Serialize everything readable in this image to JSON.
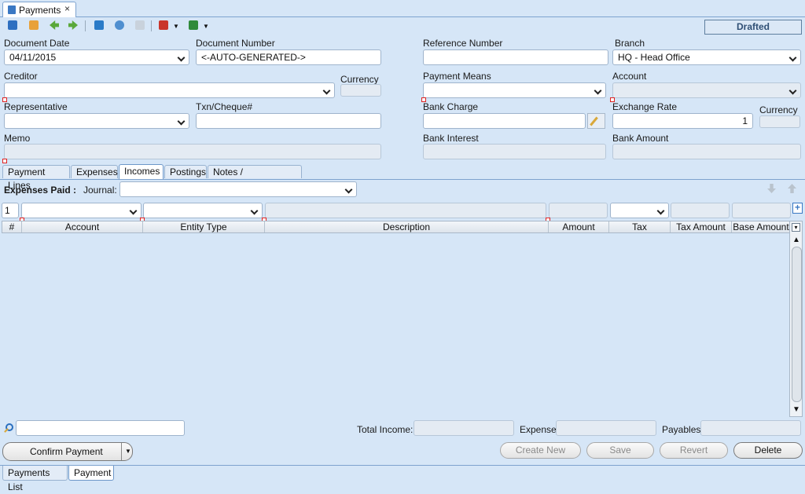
{
  "window": {
    "tab_title": "Payments",
    "close_glyph": "×",
    "status": "Drafted"
  },
  "toolbar": {
    "icons": [
      "help-icon",
      "calendar-icon",
      "back-icon",
      "forward-icon",
      "save-icon",
      "refresh-icon",
      "copy-icon",
      "report-icon",
      "excel-icon"
    ]
  },
  "form": {
    "document_date": {
      "label": "Document Date",
      "value": "04/11/2015"
    },
    "document_number": {
      "label": "Document Number",
      "value": "<-AUTO-GENERATED->"
    },
    "reference_number": {
      "label": "Reference Number",
      "value": ""
    },
    "branch": {
      "label": "Branch",
      "value": "HQ - Head Office"
    },
    "creditor": {
      "label": "Creditor",
      "value": ""
    },
    "currency": {
      "label": "Currency",
      "value": ""
    },
    "payment_means": {
      "label": "Payment Means",
      "value": ""
    },
    "account": {
      "label": "Account",
      "value": ""
    },
    "representative": {
      "label": "Representative",
      "value": ""
    },
    "txn_cheque": {
      "label": "Txn/Cheque#",
      "value": ""
    },
    "bank_charge": {
      "label": "Bank Charge",
      "value": ""
    },
    "exchange_rate": {
      "label": "Exchange Rate",
      "value": "1"
    },
    "currency2": {
      "label": "Currency",
      "value": ""
    },
    "memo": {
      "label": "Memo",
      "value": ""
    },
    "bank_interest": {
      "label": "Bank Interest",
      "value": ""
    },
    "bank_amount": {
      "label": "Bank Amount",
      "value": ""
    }
  },
  "subtabs": [
    "Payment Lines",
    "Expenses",
    "Incomes",
    "Postings",
    "Notes / Attachments"
  ],
  "active_subtab": "Incomes",
  "expenses_paid": {
    "label": "Expenses Paid :",
    "journal_label": "Journal:",
    "journal_value": ""
  },
  "entry_row": {
    "line_no": "1"
  },
  "grid": {
    "columns": [
      "#",
      "Account",
      "Entity Type",
      "Description",
      "Amount",
      "Tax",
      "Tax Amount",
      "Base Amount"
    ]
  },
  "footer": {
    "search_value": "",
    "total_income_label": "Total Income:",
    "expense_label": "Expense:",
    "payables_label": "Payables:"
  },
  "actions": {
    "confirm": "Confirm Payment",
    "create_new": "Create New",
    "save": "Save",
    "revert": "Revert",
    "delete": "Delete"
  },
  "bottom_tabs": [
    "Payments List",
    "Payment"
  ],
  "active_bottom_tab": "Payment"
}
